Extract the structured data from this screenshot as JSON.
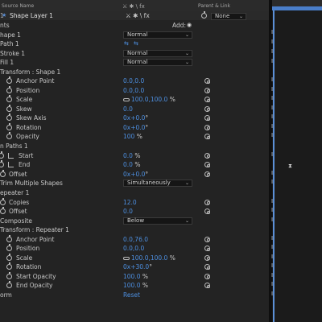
{
  "header": {
    "source_name": "Source Name",
    "parent_link": "Parent & Link",
    "switches": "⚔ ✱ \\ fx",
    "layer_name": "Shape Layer 1",
    "layer_number": "1",
    "parent_value": "None",
    "add_label": "Add:"
  },
  "rows": {
    "contents": "nts",
    "shape1": "hape 1",
    "shape1_blend": "Normal",
    "path1": "Path 1",
    "stroke1": "Stroke 1",
    "stroke1_blend": "Normal",
    "fill1": "Fill 1",
    "fill1_blend": "Normal",
    "transform_shape": "Transform : Shape 1",
    "anchor": "Anchor Point",
    "anchor_val": "0.0,0.0",
    "position": "Position",
    "position_val": "0.0,0.0",
    "scale": "Scale",
    "scale_val": "100.0,100.0",
    "scale_unit": "%",
    "skew": "Skew",
    "skew_val": "0.0",
    "skew_axis": "Skew Axis",
    "skew_axis_val": "0x+0.0",
    "skew_axis_unit": "°",
    "rotation": "Rotation",
    "rotation_val": "0x+0.0",
    "rotation_unit": "°",
    "opacity": "Opacity",
    "opacity_val": "100",
    "opacity_unit": "%",
    "trim": "n Paths 1",
    "start": "Start",
    "start_val": "0.0",
    "start_unit": "%",
    "end": "End",
    "end_val": "0.0",
    "end_unit": "%",
    "offset": "Offset",
    "offset_val": "0x+0.0",
    "offset_unit": "°",
    "trim_multiple": "Trim Multiple Shapes",
    "trim_multiple_val": "Simultaneously",
    "repeater": "epeater 1",
    "copies": "Copies",
    "copies_val": "12.0",
    "rep_offset": "Offset",
    "rep_offset_val": "0.0",
    "composite": "Composite",
    "composite_val": "Below",
    "transform_rep": "Transform : Repeater 1",
    "r_anchor": "Anchor Point",
    "r_anchor_val": "0.0,76.0",
    "r_position": "Position",
    "r_position_val": "0.0,0.0",
    "r_scale": "Scale",
    "r_scale_val": "100.0,100.0",
    "r_scale_unit": "%",
    "r_rotation": "Rotation",
    "r_rotation_val": "0x+30.0",
    "r_rotation_unit": "°",
    "start_opacity": "Start Opacity",
    "start_opacity_val": "100.0",
    "start_opacity_unit": "%",
    "end_opacity": "End Opacity",
    "end_opacity_val": "100.0",
    "end_opacity_unit": "%",
    "transform": "orm",
    "transform_val": "Reset"
  },
  "icons": {
    "dropdown": "chevron-down-icon",
    "spiral": "spiral-icon",
    "stopwatch": "stopwatch-icon",
    "chain": "chain-link-icon",
    "keyframe": "keyframe-icon"
  },
  "colors": {
    "value_blue": "#4d8fe0",
    "panel_bg": "#232323",
    "timeline_bar": "#4a7ec9"
  }
}
